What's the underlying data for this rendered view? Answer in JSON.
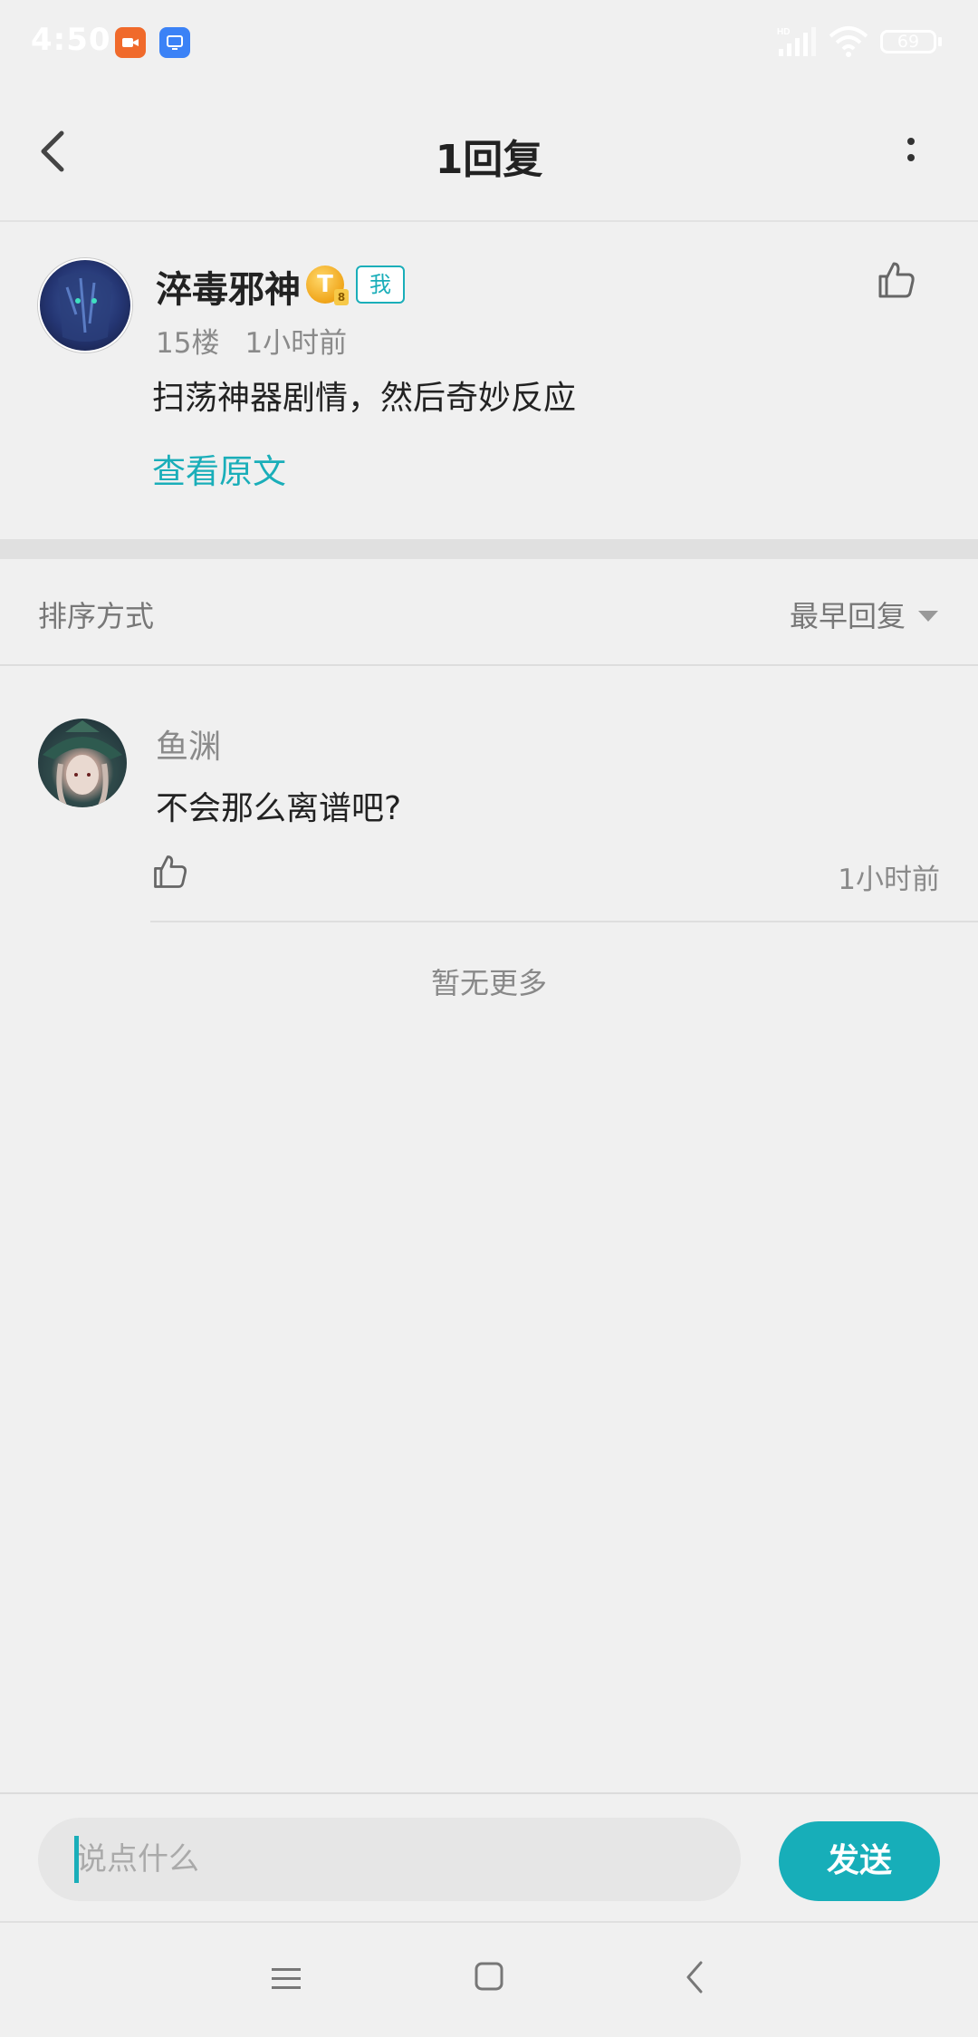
{
  "status_bar": {
    "time": "4:50",
    "battery": "69",
    "icons": [
      "video-app-icon",
      "screen-app-icon",
      "hd-signal-icon",
      "wifi-icon",
      "battery-icon"
    ]
  },
  "header": {
    "title": "1回复",
    "back_icon": "chevron-left-icon",
    "more_icon": "vertical-dots-icon"
  },
  "post": {
    "username": "淬毒邪神",
    "level_badge": "T",
    "level_sub": "8",
    "me_badge": "我",
    "floor": "15楼",
    "time": "1小时前",
    "content": "扫荡神器剧情，然后奇妙反应",
    "view_original": "查看原文"
  },
  "sort": {
    "label": "排序方式",
    "selected": "最早回复"
  },
  "replies": [
    {
      "username": "鱼渊",
      "content": "不会那么离谱吧?",
      "time": "1小时前"
    }
  ],
  "no_more": "暂无更多",
  "input": {
    "placeholder": "说点什么",
    "send_label": "发送"
  },
  "colors": {
    "accent": "#1aaeb9",
    "background": "#f0f0f0",
    "text_primary": "#222222",
    "text_secondary": "#8a8a8a"
  }
}
